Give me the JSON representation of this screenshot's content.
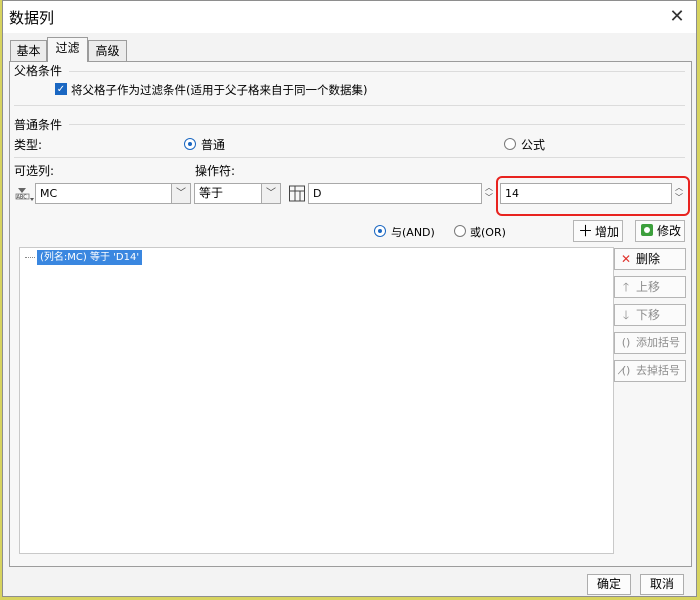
{
  "dialog": {
    "title": "数据列",
    "close_glyph": "✕"
  },
  "tabs": [
    {
      "label": "基本"
    },
    {
      "label": "过滤"
    },
    {
      "label": "高级"
    }
  ],
  "parent_condition": {
    "section_label": "父格条件",
    "checkbox_label": "将父格子作为过滤条件(适用于父子格来自于同一个数据集)",
    "checked": true
  },
  "normal_condition": {
    "section_label": "普通条件",
    "type_label": "类型:",
    "type_options": [
      {
        "label": "普通",
        "selected": true
      },
      {
        "label": "公式",
        "selected": false
      }
    ],
    "column_label": "可选列:",
    "operator_label": "操作符:",
    "column_value": "MC",
    "operator_value": "等于",
    "value_field_1": "D",
    "value_field_2": "14"
  },
  "logic": {
    "and_label": "与(AND)",
    "or_label": "或(OR)",
    "and_selected": true
  },
  "buttons": {
    "add": "增加",
    "modify": "修改",
    "delete": "删除",
    "move_up": "上移",
    "move_down": "下移",
    "add_bracket": "添加括号",
    "remove_bracket": "去掉括号",
    "ok": "确定",
    "cancel": "取消"
  },
  "condition_list": [
    {
      "text": "(列名:MC) 等于 'D14'",
      "selected": true
    }
  ],
  "colors": {
    "accent": "#1a67c2",
    "selection": "#3a87e0",
    "highlight_box": "#e8231f",
    "delete_icon": "#e0332d"
  },
  "icons": {
    "column_type": "abc-column-icon",
    "field_type": "table-field-icon",
    "add": "plus-icon",
    "modify": "edit-icon",
    "delete": "x-icon",
    "move_up": "arrow-up-icon",
    "move_down": "arrow-down-icon",
    "add_bracket": "bracket-icon",
    "remove_bracket": "bracket-remove-icon"
  }
}
